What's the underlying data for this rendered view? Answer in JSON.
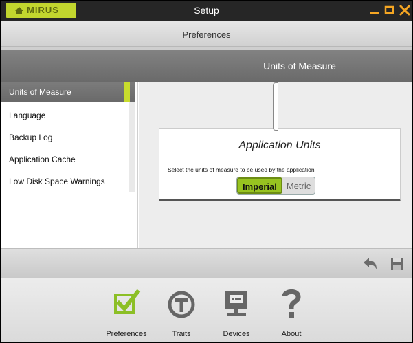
{
  "window": {
    "app_logo": "MIRUS",
    "title": "Setup"
  },
  "header": {
    "section_title": "Preferences",
    "page_title": "Units of Measure"
  },
  "sidebar": {
    "items": [
      {
        "label": "Units of Measure",
        "active": true
      },
      {
        "label": "Language"
      },
      {
        "label": "Backup Log"
      },
      {
        "label": "Application Cache"
      },
      {
        "label": "Low Disk Space Warnings"
      }
    ]
  },
  "units_panel": {
    "title": "Application Units",
    "description": "Select the units of measure to be used by the application",
    "options": [
      "Imperial",
      "Metric"
    ],
    "selected": "Imperial"
  },
  "bottom_nav": {
    "items": [
      {
        "label": "Preferences",
        "icon": "checkbox-icon"
      },
      {
        "label": "Traits",
        "icon": "traits-icon"
      },
      {
        "label": "Devices",
        "icon": "devices-icon"
      },
      {
        "label": "About",
        "icon": "question-icon"
      }
    ]
  },
  "colors": {
    "accent": "#c8dc2d",
    "selected": "#97c320",
    "close": "#f5a623"
  }
}
